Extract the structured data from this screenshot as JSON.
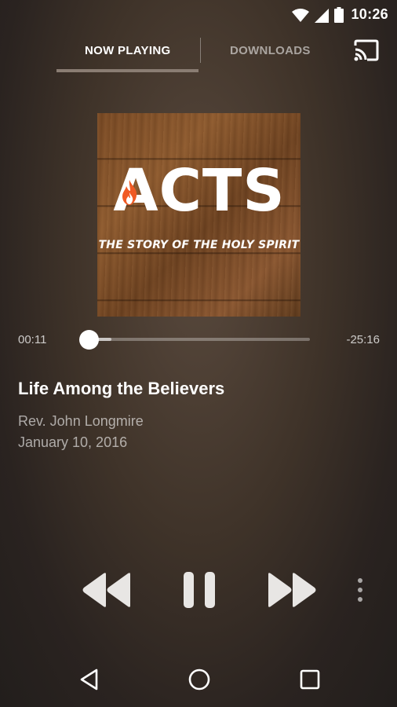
{
  "status_bar": {
    "time": "10:26",
    "icons": [
      "wifi-icon",
      "cellular-signal-icon",
      "battery-icon"
    ]
  },
  "tabs": {
    "now_playing": "NOW PLAYING",
    "downloads": "DOWNLOADS",
    "active": "NOW PLAYING"
  },
  "artwork": {
    "title": "ACTS",
    "subtitle": "THE STORY OF THE HOLY SPIRIT",
    "accent_color": "#f05a24"
  },
  "player": {
    "elapsed": "00:11",
    "remaining": "-25:16",
    "progress_fraction": 0.007,
    "track_title": "Life Among the Believers",
    "speaker": "Rev. John Longmire",
    "date": "January 10, 2016"
  },
  "controls": [
    "rewind-icon",
    "pause-icon",
    "fast-forward-icon",
    "more-vert-icon"
  ],
  "nav_bar": [
    "back-icon",
    "home-icon",
    "recents-icon"
  ]
}
